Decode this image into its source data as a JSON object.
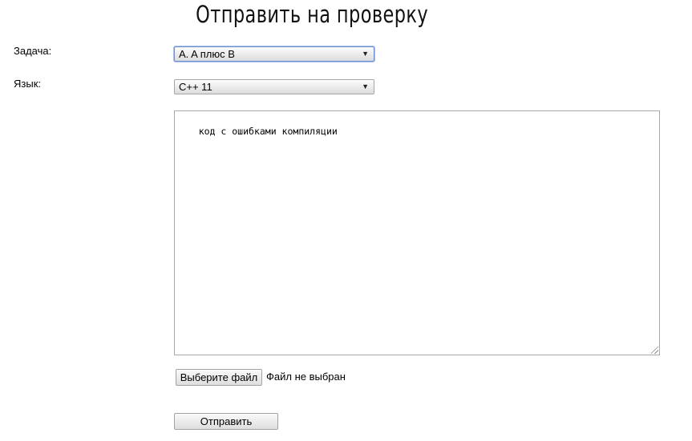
{
  "page": {
    "title": "Отправить на проверку"
  },
  "form": {
    "problem": {
      "label": "Задача:",
      "selected": "A. A плюс B"
    },
    "language": {
      "label": "Язык:",
      "selected": "C++ 11"
    },
    "code": {
      "value": "код с ошибками компиляции"
    },
    "file": {
      "button_label": "Выберите файл",
      "status": "Файл не выбран"
    },
    "submit_label": "Отправить"
  },
  "icons": {
    "dropdown": "chevron-down-icon",
    "resize": "resize-grip-icon"
  },
  "colors": {
    "focus_border": "#6d8fd0",
    "background": "#ffffff"
  }
}
